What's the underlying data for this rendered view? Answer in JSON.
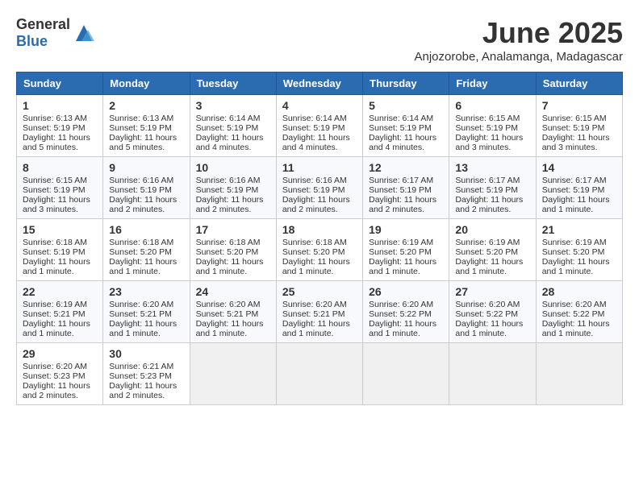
{
  "header": {
    "logo_general": "General",
    "logo_blue": "Blue",
    "month_year": "June 2025",
    "location": "Anjozorobe, Analamanga, Madagascar"
  },
  "weekdays": [
    "Sunday",
    "Monday",
    "Tuesday",
    "Wednesday",
    "Thursday",
    "Friday",
    "Saturday"
  ],
  "weeks": [
    [
      {
        "day": "1",
        "sunrise": "6:13 AM",
        "sunset": "5:19 PM",
        "daylight": "11 hours and 5 minutes."
      },
      {
        "day": "2",
        "sunrise": "6:13 AM",
        "sunset": "5:19 PM",
        "daylight": "11 hours and 5 minutes."
      },
      {
        "day": "3",
        "sunrise": "6:14 AM",
        "sunset": "5:19 PM",
        "daylight": "11 hours and 4 minutes."
      },
      {
        "day": "4",
        "sunrise": "6:14 AM",
        "sunset": "5:19 PM",
        "daylight": "11 hours and 4 minutes."
      },
      {
        "day": "5",
        "sunrise": "6:14 AM",
        "sunset": "5:19 PM",
        "daylight": "11 hours and 4 minutes."
      },
      {
        "day": "6",
        "sunrise": "6:15 AM",
        "sunset": "5:19 PM",
        "daylight": "11 hours and 3 minutes."
      },
      {
        "day": "7",
        "sunrise": "6:15 AM",
        "sunset": "5:19 PM",
        "daylight": "11 hours and 3 minutes."
      }
    ],
    [
      {
        "day": "8",
        "sunrise": "6:15 AM",
        "sunset": "5:19 PM",
        "daylight": "11 hours and 3 minutes."
      },
      {
        "day": "9",
        "sunrise": "6:16 AM",
        "sunset": "5:19 PM",
        "daylight": "11 hours and 2 minutes."
      },
      {
        "day": "10",
        "sunrise": "6:16 AM",
        "sunset": "5:19 PM",
        "daylight": "11 hours and 2 minutes."
      },
      {
        "day": "11",
        "sunrise": "6:16 AM",
        "sunset": "5:19 PM",
        "daylight": "11 hours and 2 minutes."
      },
      {
        "day": "12",
        "sunrise": "6:17 AM",
        "sunset": "5:19 PM",
        "daylight": "11 hours and 2 minutes."
      },
      {
        "day": "13",
        "sunrise": "6:17 AM",
        "sunset": "5:19 PM",
        "daylight": "11 hours and 2 minutes."
      },
      {
        "day": "14",
        "sunrise": "6:17 AM",
        "sunset": "5:19 PM",
        "daylight": "11 hours and 1 minute."
      }
    ],
    [
      {
        "day": "15",
        "sunrise": "6:18 AM",
        "sunset": "5:19 PM",
        "daylight": "11 hours and 1 minute."
      },
      {
        "day": "16",
        "sunrise": "6:18 AM",
        "sunset": "5:20 PM",
        "daylight": "11 hours and 1 minute."
      },
      {
        "day": "17",
        "sunrise": "6:18 AM",
        "sunset": "5:20 PM",
        "daylight": "11 hours and 1 minute."
      },
      {
        "day": "18",
        "sunrise": "6:18 AM",
        "sunset": "5:20 PM",
        "daylight": "11 hours and 1 minute."
      },
      {
        "day": "19",
        "sunrise": "6:19 AM",
        "sunset": "5:20 PM",
        "daylight": "11 hours and 1 minute."
      },
      {
        "day": "20",
        "sunrise": "6:19 AM",
        "sunset": "5:20 PM",
        "daylight": "11 hours and 1 minute."
      },
      {
        "day": "21",
        "sunrise": "6:19 AM",
        "sunset": "5:20 PM",
        "daylight": "11 hours and 1 minute."
      }
    ],
    [
      {
        "day": "22",
        "sunrise": "6:19 AM",
        "sunset": "5:21 PM",
        "daylight": "11 hours and 1 minute."
      },
      {
        "day": "23",
        "sunrise": "6:20 AM",
        "sunset": "5:21 PM",
        "daylight": "11 hours and 1 minute."
      },
      {
        "day": "24",
        "sunrise": "6:20 AM",
        "sunset": "5:21 PM",
        "daylight": "11 hours and 1 minute."
      },
      {
        "day": "25",
        "sunrise": "6:20 AM",
        "sunset": "5:21 PM",
        "daylight": "11 hours and 1 minute."
      },
      {
        "day": "26",
        "sunrise": "6:20 AM",
        "sunset": "5:22 PM",
        "daylight": "11 hours and 1 minute."
      },
      {
        "day": "27",
        "sunrise": "6:20 AM",
        "sunset": "5:22 PM",
        "daylight": "11 hours and 1 minute."
      },
      {
        "day": "28",
        "sunrise": "6:20 AM",
        "sunset": "5:22 PM",
        "daylight": "11 hours and 1 minute."
      }
    ],
    [
      {
        "day": "29",
        "sunrise": "6:20 AM",
        "sunset": "5:23 PM",
        "daylight": "11 hours and 2 minutes."
      },
      {
        "day": "30",
        "sunrise": "6:21 AM",
        "sunset": "5:23 PM",
        "daylight": "11 hours and 2 minutes."
      },
      null,
      null,
      null,
      null,
      null
    ]
  ],
  "labels": {
    "sunrise": "Sunrise: ",
    "sunset": "Sunset: ",
    "daylight": "Daylight: "
  }
}
